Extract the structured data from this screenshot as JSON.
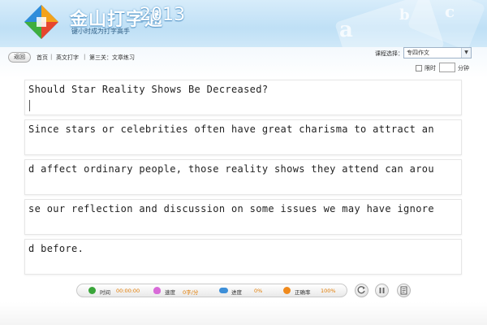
{
  "header": {
    "logo_text": "金山打字通",
    "year": "2013",
    "slogan": "键小时成为打字高手"
  },
  "nav": {
    "back_label": "返回",
    "breadcrumb": [
      "首页",
      "英文打字",
      "第三关：文章练习"
    ]
  },
  "course": {
    "label": "课程选择：",
    "selected": "专四作文"
  },
  "time_limit": {
    "label": "限时",
    "value": "",
    "unit": "分钟"
  },
  "lines": [
    "Should Star Reality Shows Be Decreased?",
    "Since stars or celebrities often have great charisma to attract an",
    "d affect ordinary people, those reality shows they attend can arou",
    "se our reflection and discussion on some issues we may have ignore",
    "d before."
  ],
  "status": {
    "time_label": "时间",
    "time_value": "00:00:00",
    "speed_label": "速度",
    "speed_value": "0字/分",
    "progress_label": "进度",
    "progress_value": "0%",
    "accuracy_label": "正确率",
    "accuracy_value": "100%"
  },
  "colors": {
    "time_icon": "#3aa53a",
    "speed_icon": "#d86bd8",
    "progress_icon": "#3d8fd8",
    "accuracy_icon": "#f08a1c",
    "value_text": "#e07a00"
  },
  "icons": {
    "restart": "restart-icon",
    "pause": "pause-icon",
    "report": "report-icon"
  }
}
